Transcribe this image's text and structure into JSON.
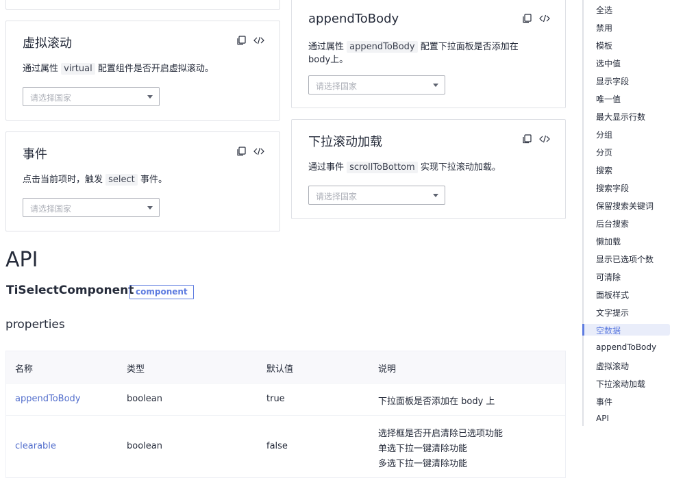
{
  "cards": {
    "virtual": {
      "title": "虚拟滚动",
      "desc_prefix": "通过属性",
      "desc_code": "virtual",
      "desc_suffix": "配置组件是否开启虚拟滚动。",
      "placeholder": "请选择国家"
    },
    "event": {
      "title": "事件",
      "desc_prefix": "点击当前项时，触发",
      "desc_code": "select",
      "desc_suffix": "事件。",
      "placeholder": "请选择国家"
    },
    "append": {
      "title": "appendToBody",
      "desc_prefix": "通过属性",
      "desc_code": "appendToBody",
      "desc_suffix": "配置下拉面板是否添加在",
      "desc_line2": "body上。",
      "placeholder": "请选择国家"
    },
    "scroll": {
      "title": "下拉滚动加载",
      "desc_prefix": "通过事件",
      "desc_code": "scrollToBottom",
      "desc_suffix": "实现下拉滚动加载。",
      "placeholder": "请选择国家"
    }
  },
  "api": {
    "title": "API",
    "component": "TiSelectComponent",
    "tag": "component",
    "props_title": "properties",
    "headers": [
      "名称",
      "类型",
      "默认值",
      "说明"
    ],
    "rows": [
      {
        "name": "appendToBody",
        "type": "boolean",
        "default": "true",
        "desc": [
          "下拉面板是否添加在 body 上"
        ]
      },
      {
        "name": "clearable",
        "type": "boolean",
        "default": "false",
        "desc": [
          "选择框是否开启清除已选项功能",
          "单选下拉一键清除功能",
          "多选下拉一键清除功能"
        ]
      }
    ]
  },
  "toc": {
    "items": [
      "全选",
      "禁用",
      "模板",
      "选中值",
      "显示字段",
      "唯一值",
      "最大显示行数",
      "分组",
      "分页",
      "搜索",
      "搜索字段",
      "保留搜索关键词",
      "后台搜索",
      "懒加载",
      "显示已选项个数",
      "可清除",
      "面板样式",
      "文字提示",
      "空数据",
      "appendToBody",
      "虚拟滚动",
      "下拉滚动加载",
      "事件",
      "API"
    ],
    "active": "空数据",
    "active_color": "#5e7ce0"
  }
}
